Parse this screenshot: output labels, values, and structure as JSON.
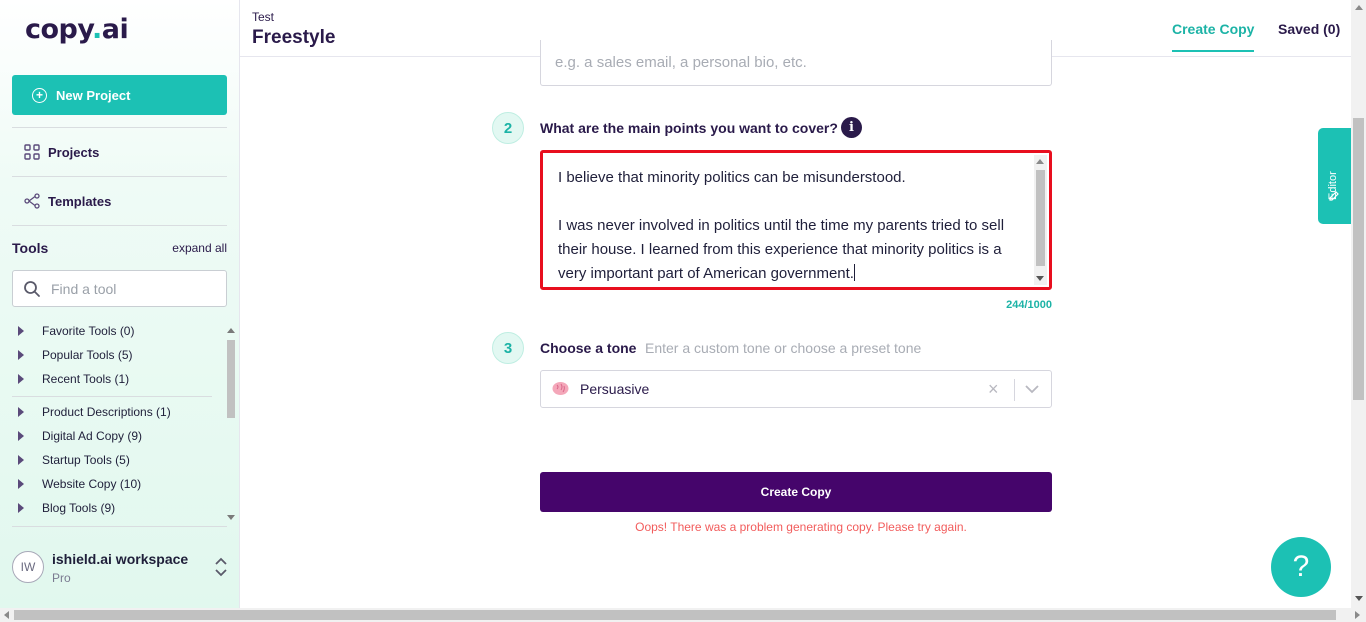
{
  "sidebar": {
    "logo_main": "copy",
    "logo_dot": ".",
    "logo_suffix": "ai",
    "new_project_label": "New Project",
    "nav": [
      {
        "label": "Projects",
        "icon": "grid-icon"
      },
      {
        "label": "Templates",
        "icon": "share-nodes-icon"
      }
    ],
    "tools_title": "Tools",
    "expand_all": "expand all",
    "search_placeholder": "Find a tool",
    "tool_groups": [
      {
        "label": "Favorite Tools (0)"
      },
      {
        "label": "Popular Tools (5)"
      },
      {
        "label": "Recent Tools (1)"
      },
      {
        "label": "Product Descriptions (1)"
      },
      {
        "label": "Digital Ad Copy (9)"
      },
      {
        "label": "Startup Tools (5)"
      },
      {
        "label": "Website Copy (10)"
      },
      {
        "label": "Blog Tools (9)"
      }
    ],
    "workspace": {
      "initials": "IW",
      "name": "ishield.ai workspace",
      "plan": "Pro"
    }
  },
  "header": {
    "breadcrumb": "Test",
    "title": "Freestyle",
    "tabs": [
      {
        "label": "Create Copy",
        "active": true
      },
      {
        "label": "Saved (0)",
        "active": false
      }
    ]
  },
  "form": {
    "step1": {
      "placeholder": "e.g. a sales email, a personal bio, etc."
    },
    "step2": {
      "number": "2",
      "label": "What are the main points you want to cover?",
      "info_icon": "i",
      "value": "I believe that minority politics can be misunderstood.\n\nI was never involved in politics until the time my parents tried to sell their house. I learned from this experience that minority politics is a very important part of American government.",
      "char_count": "244/1000"
    },
    "step3": {
      "number": "3",
      "label": "Choose a tone",
      "hint": "Enter a custom tone or choose a preset tone",
      "selected_icon": "brain-icon",
      "selected_value": "Persuasive",
      "clear_glyph": "×"
    },
    "submit_label": "Create Copy",
    "error_message": "Oops! There was a problem generating copy. Please try again."
  },
  "editor_tab_label": "Editor",
  "help_glyph": "?",
  "colors": {
    "accent": "#1cc1b4",
    "primary_button": "#45056b",
    "highlight_border": "#e80e1e",
    "error": "#f25c5c"
  }
}
